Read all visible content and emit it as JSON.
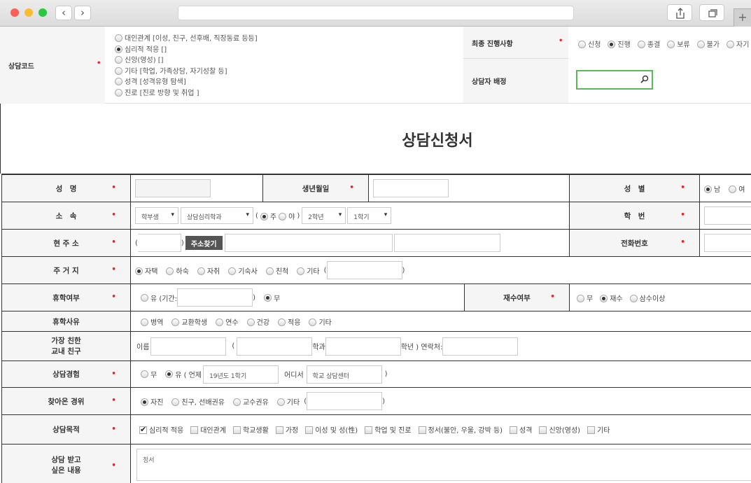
{
  "counsel_code": {
    "label": "상담코드",
    "options": [
      "대인관계 [이성, 친구, 선후배, 직장동료 등등]",
      "심리적 적응 []",
      "신앙(영성) []",
      "기타 [학업, 가족상담, 자기성찰 등]",
      "성격 [성격유형 탐색]",
      "진로 [진로 방향 및 취업 ]"
    ],
    "selected_index": 1
  },
  "final_progress": {
    "label": "최종 진행사항",
    "options": [
      "신청",
      "진행",
      "종결",
      "보류",
      "불가",
      "자기"
    ],
    "selected_index": 1
  },
  "counselor_assign": {
    "label": "상담자 배정",
    "value": ""
  },
  "form_title": "상담신청서",
  "form": {
    "name": {
      "label": "성　명",
      "value": ""
    },
    "birth": {
      "label": "생년월일",
      "value": ""
    },
    "gender": {
      "label": "성　별",
      "options": [
        "남",
        "여"
      ],
      "selected_index": 0
    },
    "affiliation": {
      "label": "소　속",
      "type_select": "학부생",
      "dept_select": "상담심리학과",
      "paren_open": "(",
      "paren_close": ")",
      "time_options": [
        "주",
        "야"
      ],
      "time_selected_index": 0,
      "grade_select": "2학년",
      "semester_select": "1학기"
    },
    "student_no": {
      "label": "학　번",
      "value": ""
    },
    "address": {
      "label": "현 주 소",
      "search_button": "주소찾기",
      "paren_open": "(",
      "paren_close": ")"
    },
    "phone": {
      "label": "전화번호"
    },
    "residence": {
      "label": "주 거 지",
      "options": [
        "자택",
        "하숙",
        "자취",
        "기숙사",
        "친척",
        "기타"
      ],
      "selected_index": 0,
      "paren_open": "(",
      "paren_close": ")"
    },
    "leave": {
      "label": "휴학여부",
      "yes_label": "유 (기간:",
      "paren_close": ")",
      "no_label": "무",
      "selected": "no"
    },
    "retake": {
      "label": "재수여부",
      "options": [
        "무",
        "재수",
        "삼수이상"
      ],
      "selected_index": 1
    },
    "leave_reason": {
      "label": "휴학사유",
      "options": [
        "병역",
        "교환학생",
        "연수",
        "건강",
        "적응",
        "기타"
      ]
    },
    "close_friend": {
      "label_line1": "가장 친한",
      "label_line2": "교내 친구",
      "name_label": "이름",
      "paren_open": "(",
      "dept_label": "학과",
      "grade_label": "학년 ) 연락처:"
    },
    "experience": {
      "label": "상담경험",
      "no_label": "무",
      "yes_label": "유 ( 언제",
      "when_value": "19년도 1학기",
      "where_label": "어디서",
      "where_value": "학교 상담센터",
      "paren_close": ")",
      "selected": "yes"
    },
    "route": {
      "label": "찾아온 경위",
      "options": [
        "자진",
        "친구, 선배권유",
        "교수권유",
        "기타"
      ],
      "selected_index": 0,
      "paren_open": "(",
      "paren_close": ")"
    },
    "purpose": {
      "label": "상담목적",
      "options": [
        "심리적 적응",
        "대인관계",
        "학교생활",
        "가정",
        "이성 및 성(性)",
        "학업 및 진로",
        "정서(불안, 우울, 강박 등)",
        "성격",
        "신앙(영성)",
        "기타"
      ],
      "checked_index": 0
    },
    "content": {
      "label_line1": "상담 받고",
      "label_line2": "싶은 내용",
      "value": "정서"
    }
  },
  "colors": {
    "required": "#e22222",
    "label_bg": "#f5f5f5",
    "search_border": "#5cb85c"
  }
}
